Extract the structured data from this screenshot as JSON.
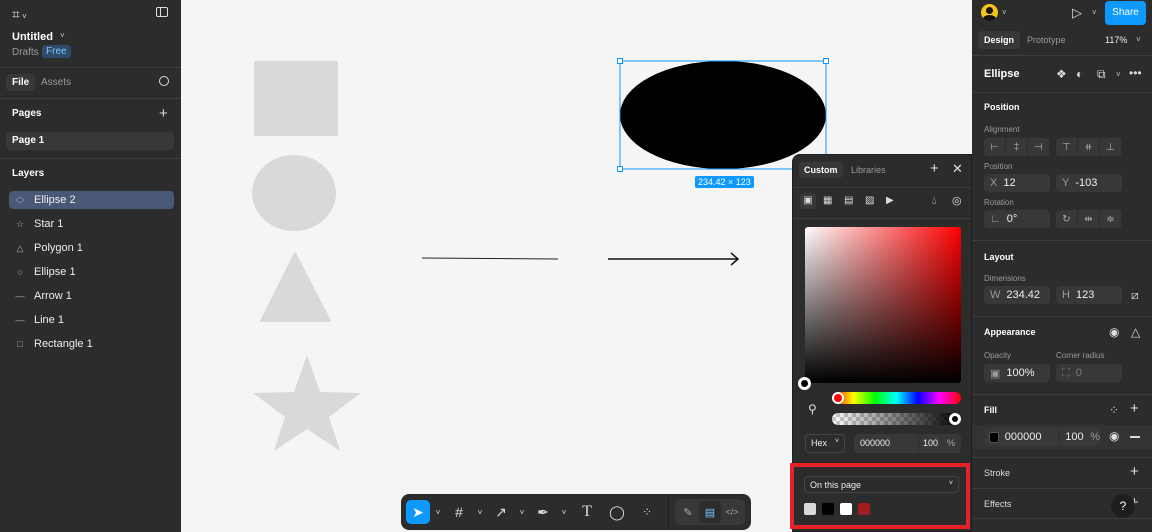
{
  "file": {
    "title": "Untitled",
    "location": "Drafts",
    "plan": "Free"
  },
  "left_tabs": {
    "file": "File",
    "assets": "Assets"
  },
  "pages": {
    "heading": "Pages",
    "items": [
      "Page 1"
    ]
  },
  "layers": {
    "heading": "Layers",
    "items": [
      {
        "label": "Ellipse 2",
        "icon": "ellipse-icon",
        "selected": true
      },
      {
        "label": "Star 1",
        "icon": "star-icon"
      },
      {
        "label": "Polygon 1",
        "icon": "polygon-icon"
      },
      {
        "label": "Ellipse 1",
        "icon": "circle-icon"
      },
      {
        "label": "Arrow 1",
        "icon": "arrow-line-icon"
      },
      {
        "label": "Line 1",
        "icon": "line-icon"
      },
      {
        "label": "Rectangle 1",
        "icon": "rectangle-icon"
      }
    ]
  },
  "canvas": {
    "selection_size": "234.42 × 123"
  },
  "color_picker": {
    "tabs": [
      "Custom",
      "Libraries"
    ],
    "format": "Hex",
    "hex": "000000",
    "opacity": "100",
    "percent": "%",
    "swatch_source": "On this page",
    "swatches": [
      "#d9d9d9",
      "#000000",
      "#ffffff",
      "#a51c1c"
    ]
  },
  "right": {
    "share": "Share",
    "tabs": {
      "design": "Design",
      "prototype": "Prototype"
    },
    "zoom": "117%",
    "selection": "Ellipse",
    "position": {
      "heading": "Position",
      "alignment": "Alignment",
      "position_label": "Position",
      "x_label": "X",
      "x": "12",
      "y_label": "Y",
      "y": "-103",
      "rotation_label": "Rotation",
      "rotation": "0°"
    },
    "layout": {
      "heading": "Layout",
      "dimensions": "Dimensions",
      "w_label": "W",
      "w": "234.42",
      "h_label": "H",
      "h": "123"
    },
    "appearance": {
      "heading": "Appearance",
      "opacity_label": "Opacity",
      "opacity": "100%",
      "radius_label": "Corner radius",
      "radius": "0"
    },
    "fill": {
      "heading": "Fill",
      "hex": "000000",
      "opacity": "100",
      "percent": "%"
    },
    "stroke": "Stroke",
    "effects": "Effects",
    "help": "?"
  },
  "colors": {
    "accent": "#0d99ff",
    "highlight": "#e8202a"
  }
}
